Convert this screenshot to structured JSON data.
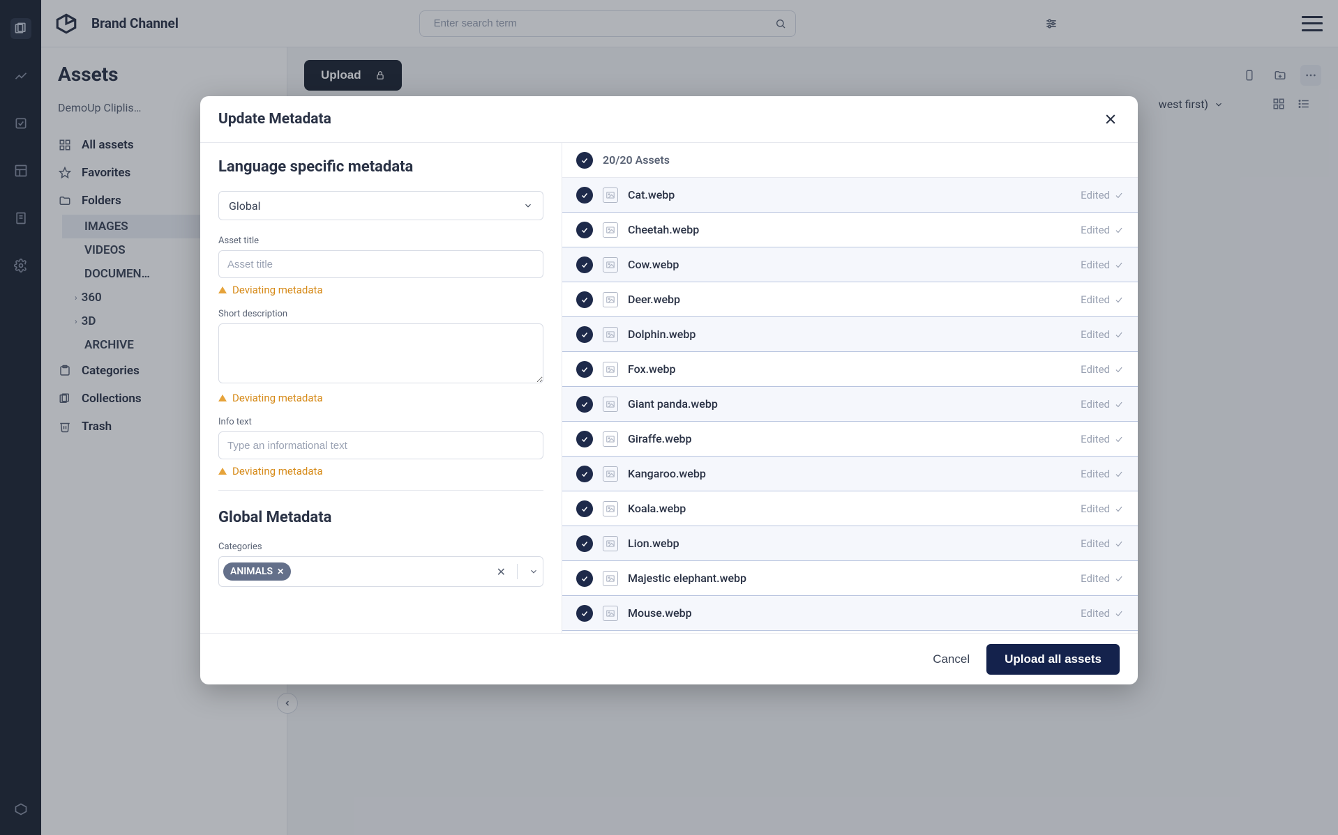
{
  "brand": "Brand Channel",
  "search": {
    "placeholder": "Enter search term"
  },
  "page_title": "Assets",
  "breadcrumb": "DemoUp Cliplis…",
  "upload_label": "Upload",
  "sort_label": "west first)",
  "nav": {
    "all_assets": "All assets",
    "favorites": "Favorites",
    "folders": "Folders",
    "subfolders": [
      "IMAGES",
      "VIDEOS",
      "DOCUMEN…",
      "360",
      "3D",
      "ARCHIVE"
    ],
    "categories": "Categories",
    "collections": "Collections",
    "trash": "Trash"
  },
  "modal": {
    "title": "Update Metadata",
    "lang_heading": "Language specific metadata",
    "global_heading": "Global Metadata",
    "lang_select": "Global",
    "labels": {
      "asset_title": "Asset title",
      "asset_title_ph": "Asset title",
      "short_desc": "Short description",
      "info_text": "Info text",
      "info_text_ph": "Type an informational text",
      "categories": "Categories"
    },
    "warning": "Deviating metadata",
    "tag": "ANIMALS",
    "assets_count": "20/20 Assets",
    "edited": "Edited",
    "cancel": "Cancel",
    "upload_all": "Upload all assets",
    "assets": [
      "Cat.webp",
      "Cheetah.webp",
      "Cow.webp",
      "Deer.webp",
      "Dolphin.webp",
      "Fox.webp",
      "Giant panda.webp",
      "Giraffe.webp",
      "Kangaroo.webp",
      "Koala.webp",
      "Lion.webp",
      "Majestic elephant.webp",
      "Mouse.webp"
    ]
  }
}
